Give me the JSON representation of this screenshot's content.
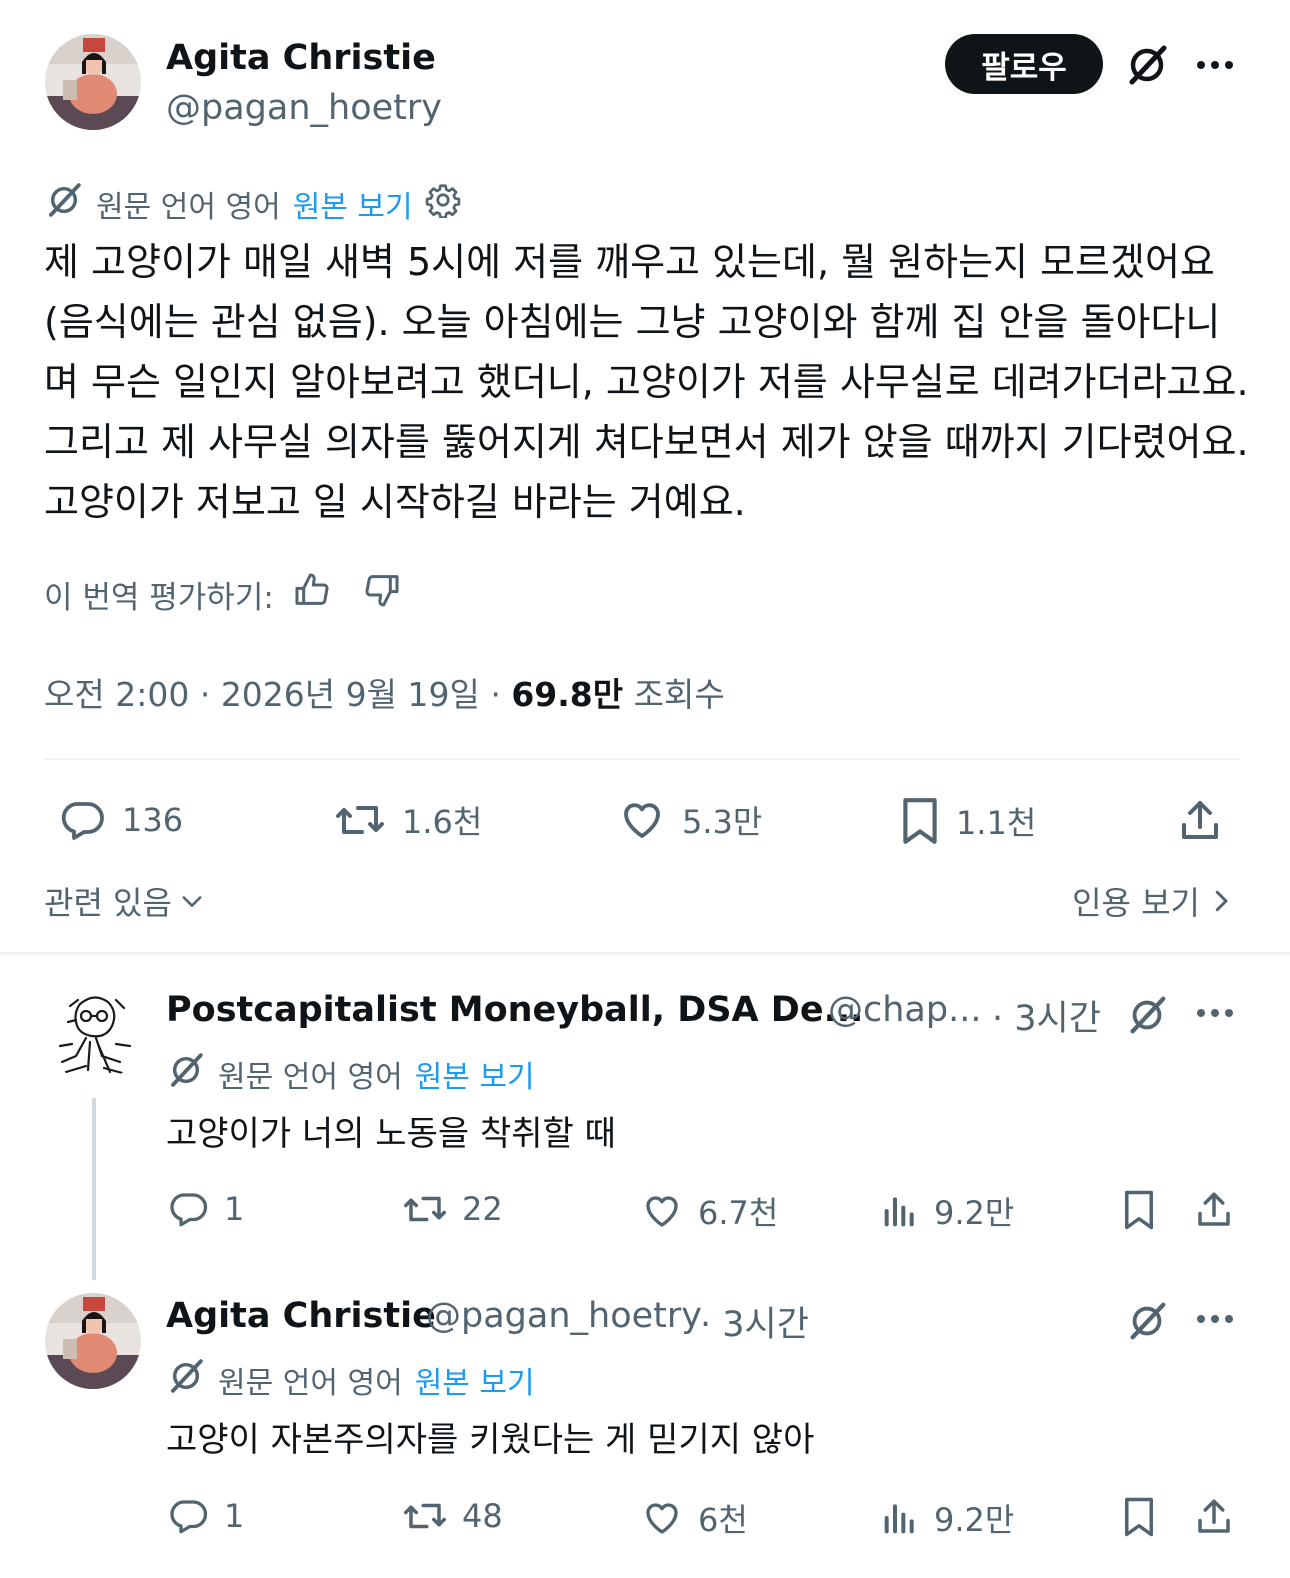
{
  "main_tweet": {
    "author_name": "Agita Christie",
    "author_handle": "@pagan_hoetry",
    "follow_label": "팔로우",
    "translation": {
      "prefix": "원문 언어 영어",
      "show_original": "원본 보기"
    },
    "text": "제 고양이가 매일 새벽 5시에 저를 깨우고 있는데, 뭘 원하는지 모르겠어요 (음식에는 관심 없음). 오늘 아침에는 그냥 고양이와 함께 집 안을 돌아다니며 무슨 일인지 알아보려고 했더니, 고양이가 저를 사무실로 데려가더라고요. 그리고 제 사무실 의자를 뚫어지게 쳐다보면서 제가 앉을 때까지 기다렸어요. 고양이가 저보고 일 시작하길 바라는 거예요.",
    "rate_label": "이 번역 평가하기:",
    "time": "오전 2:00",
    "date": "2026년 9월 19일",
    "views_count": "69.8만",
    "views_label": "조회수",
    "replies": "136",
    "retweets": "1.6천",
    "likes": "5.3만",
    "bookmarks": "1.1천",
    "related_label": "관련 있음",
    "quotes_label": "인용 보기"
  },
  "replies": [
    {
      "author_name": "Postcapitalist Moneyball, DSA De...",
      "author_handle": "@chap...",
      "time": "· 3시간",
      "translation_prefix": "원문 언어 영어",
      "show_original": "원본 보기",
      "text": "고양이가 너의 노동을 착취할 때",
      "replies": "1",
      "retweets": "22",
      "likes": "6.7천",
      "views": "9.2만"
    },
    {
      "author_name": "Agita Christie",
      "author_handle": "@pagan_hoetry",
      "time": "· 3시간",
      "translation_prefix": "원문 언어 영어",
      "show_original": "원본 보기",
      "text": "고양이 자본주의자를 키웠다는 게 믿기지 않아",
      "replies": "1",
      "retweets": "48",
      "likes": "6천",
      "views": "9.2만"
    }
  ],
  "colors": {
    "text": "#0f1419",
    "secondary": "#536471",
    "link": "#1d9bf0",
    "divider": "#eff3f4"
  },
  "icons": [
    "grok-icon",
    "more-icon",
    "translate-icon",
    "gear-icon",
    "thumbs-up-icon",
    "thumbs-down-icon",
    "reply-icon",
    "retweet-icon",
    "like-icon",
    "bookmark-icon",
    "share-icon",
    "views-icon",
    "chevron-down-icon",
    "chevron-right-icon"
  ]
}
